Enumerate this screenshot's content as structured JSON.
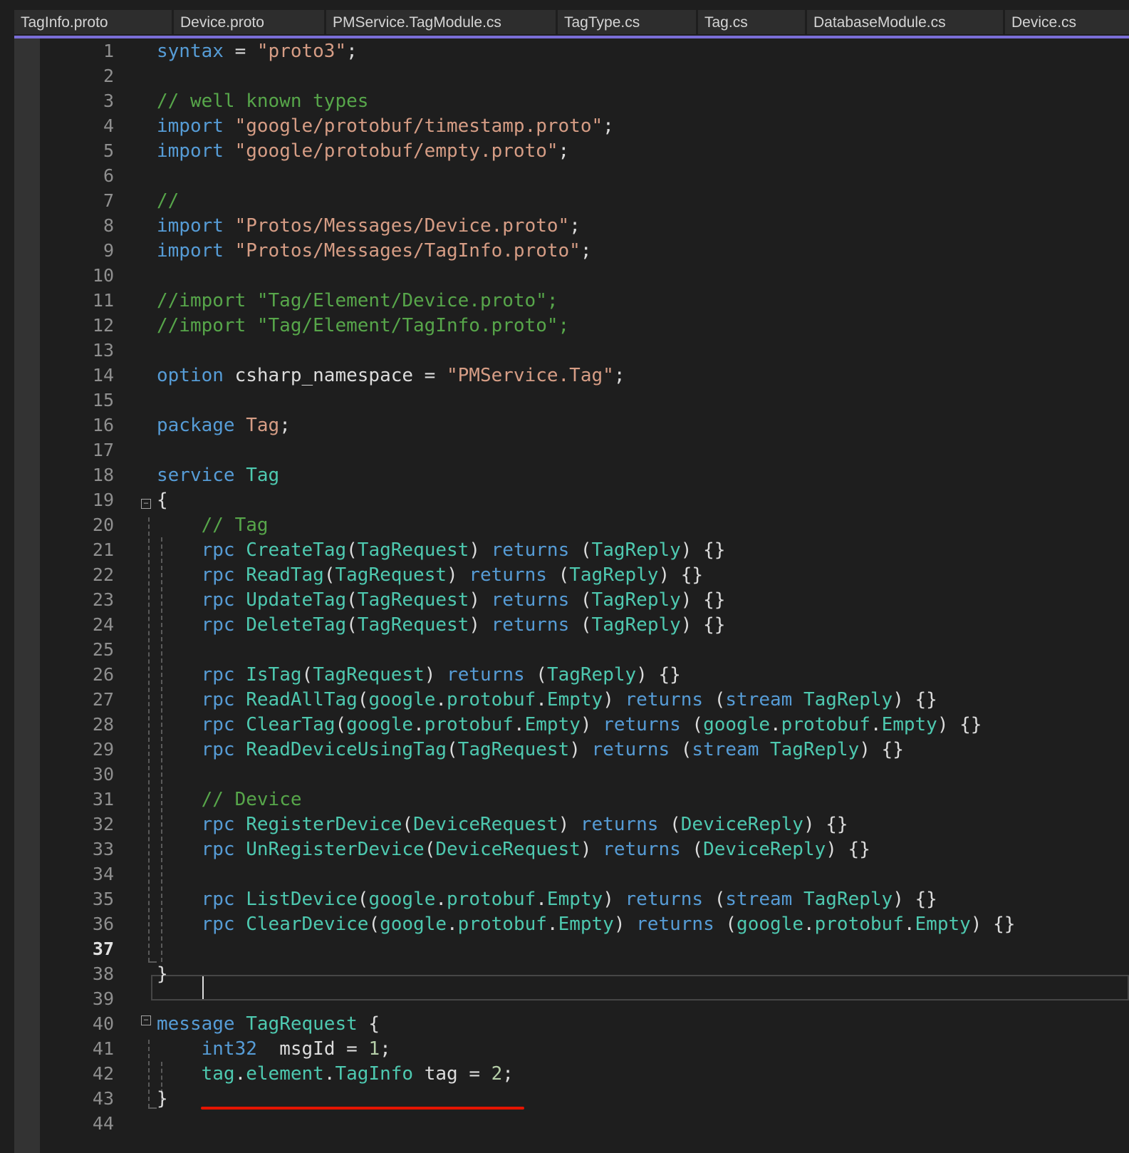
{
  "tabs": [
    {
      "label": "TagInfo.proto"
    },
    {
      "label": "Device.proto"
    },
    {
      "label": "PMService.TagModule.cs"
    },
    {
      "label": "TagType.cs"
    },
    {
      "label": "Tag.cs"
    },
    {
      "label": "DatabaseModule.cs"
    },
    {
      "label": "Device.cs"
    }
  ],
  "editor": {
    "active_line": 37,
    "lines": [
      {
        "n": "1",
        "tokens": [
          [
            "kw",
            "syntax"
          ],
          [
            "",
            " = "
          ],
          [
            "str",
            "\"proto3\""
          ],
          [
            "",
            ";"
          ]
        ]
      },
      {
        "n": "2",
        "tokens": []
      },
      {
        "n": "3",
        "tokens": [
          [
            "cm",
            "// well known types"
          ]
        ]
      },
      {
        "n": "4",
        "tokens": [
          [
            "kw",
            "import"
          ],
          [
            "",
            " "
          ],
          [
            "str",
            "\"google/protobuf/timestamp.proto\""
          ],
          [
            "",
            ";"
          ]
        ]
      },
      {
        "n": "5",
        "tokens": [
          [
            "kw",
            "import"
          ],
          [
            "",
            " "
          ],
          [
            "str",
            "\"google/protobuf/empty.proto\""
          ],
          [
            "",
            ";"
          ]
        ]
      },
      {
        "n": "6",
        "tokens": []
      },
      {
        "n": "7",
        "tokens": [
          [
            "cm",
            "//"
          ]
        ]
      },
      {
        "n": "8",
        "tokens": [
          [
            "kw",
            "import"
          ],
          [
            "",
            " "
          ],
          [
            "str",
            "\"Protos/Messages/Device.proto\""
          ],
          [
            "",
            ";"
          ]
        ]
      },
      {
        "n": "9",
        "tokens": [
          [
            "kw",
            "import"
          ],
          [
            "",
            " "
          ],
          [
            "str",
            "\"Protos/Messages/TagInfo.proto\""
          ],
          [
            "",
            ";"
          ]
        ]
      },
      {
        "n": "10",
        "tokens": []
      },
      {
        "n": "11",
        "tokens": [
          [
            "cm",
            "//import \"Tag/Element/Device.proto\";"
          ]
        ]
      },
      {
        "n": "12",
        "tokens": [
          [
            "cm",
            "//import \"Tag/Element/TagInfo.proto\";"
          ]
        ]
      },
      {
        "n": "13",
        "tokens": []
      },
      {
        "n": "14",
        "tokens": [
          [
            "kw",
            "option"
          ],
          [
            "",
            " csharp_namespace = "
          ],
          [
            "str",
            "\"PMService.Tag\""
          ],
          [
            "",
            ";"
          ]
        ]
      },
      {
        "n": "15",
        "tokens": []
      },
      {
        "n": "16",
        "tokens": [
          [
            "kw",
            "package"
          ],
          [
            "",
            " "
          ],
          [
            "str",
            "Tag"
          ],
          [
            "",
            ";"
          ]
        ]
      },
      {
        "n": "17",
        "tokens": []
      },
      {
        "n": "18",
        "tokens": [
          [
            "kw",
            "service"
          ],
          [
            "",
            " "
          ],
          [
            "ty",
            "Tag"
          ]
        ]
      },
      {
        "n": "19",
        "tokens": [
          [
            "",
            "{"
          ]
        ]
      },
      {
        "n": "20",
        "tokens": [
          [
            "",
            "    "
          ],
          [
            "cm",
            "// Tag"
          ]
        ]
      },
      {
        "n": "21",
        "tokens": [
          [
            "",
            "    "
          ],
          [
            "kw",
            "rpc"
          ],
          [
            "",
            " "
          ],
          [
            "ty",
            "CreateTag"
          ],
          [
            "",
            "("
          ],
          [
            "ty",
            "TagRequest"
          ],
          [
            "",
            ") "
          ],
          [
            "kw",
            "returns"
          ],
          [
            "",
            " ("
          ],
          [
            "ty",
            "TagReply"
          ],
          [
            "",
            ") {}"
          ]
        ]
      },
      {
        "n": "22",
        "tokens": [
          [
            "",
            "    "
          ],
          [
            "kw",
            "rpc"
          ],
          [
            "",
            " "
          ],
          [
            "ty",
            "ReadTag"
          ],
          [
            "",
            "("
          ],
          [
            "ty",
            "TagRequest"
          ],
          [
            "",
            ") "
          ],
          [
            "kw",
            "returns"
          ],
          [
            "",
            " ("
          ],
          [
            "ty",
            "TagReply"
          ],
          [
            "",
            ") {}"
          ]
        ]
      },
      {
        "n": "23",
        "tokens": [
          [
            "",
            "    "
          ],
          [
            "kw",
            "rpc"
          ],
          [
            "",
            " "
          ],
          [
            "ty",
            "UpdateTag"
          ],
          [
            "",
            "("
          ],
          [
            "ty",
            "TagRequest"
          ],
          [
            "",
            ") "
          ],
          [
            "kw",
            "returns"
          ],
          [
            "",
            " ("
          ],
          [
            "ty",
            "TagReply"
          ],
          [
            "",
            ") {}"
          ]
        ]
      },
      {
        "n": "24",
        "tokens": [
          [
            "",
            "    "
          ],
          [
            "kw",
            "rpc"
          ],
          [
            "",
            " "
          ],
          [
            "ty",
            "DeleteTag"
          ],
          [
            "",
            "("
          ],
          [
            "ty",
            "TagRequest"
          ],
          [
            "",
            ") "
          ],
          [
            "kw",
            "returns"
          ],
          [
            "",
            " ("
          ],
          [
            "ty",
            "TagReply"
          ],
          [
            "",
            ") {}"
          ]
        ]
      },
      {
        "n": "25",
        "tokens": []
      },
      {
        "n": "26",
        "tokens": [
          [
            "",
            "    "
          ],
          [
            "kw",
            "rpc"
          ],
          [
            "",
            " "
          ],
          [
            "ty",
            "IsTag"
          ],
          [
            "",
            "("
          ],
          [
            "ty",
            "TagRequest"
          ],
          [
            "",
            ") "
          ],
          [
            "kw",
            "returns"
          ],
          [
            "",
            " ("
          ],
          [
            "ty",
            "TagReply"
          ],
          [
            "",
            ") {}"
          ]
        ]
      },
      {
        "n": "27",
        "tokens": [
          [
            "",
            "    "
          ],
          [
            "kw",
            "rpc"
          ],
          [
            "",
            " "
          ],
          [
            "ty",
            "ReadAllTag"
          ],
          [
            "",
            "("
          ],
          [
            "ty",
            "google"
          ],
          [
            "",
            "."
          ],
          [
            "ty",
            "protobuf"
          ],
          [
            "",
            "."
          ],
          [
            "ty",
            "Empty"
          ],
          [
            "",
            ") "
          ],
          [
            "kw",
            "returns"
          ],
          [
            "",
            " ("
          ],
          [
            "kw",
            "stream"
          ],
          [
            "",
            " "
          ],
          [
            "ty",
            "TagReply"
          ],
          [
            "",
            ") {}"
          ]
        ]
      },
      {
        "n": "28",
        "tokens": [
          [
            "",
            "    "
          ],
          [
            "kw",
            "rpc"
          ],
          [
            "",
            " "
          ],
          [
            "ty",
            "ClearTag"
          ],
          [
            "",
            "("
          ],
          [
            "ty",
            "google"
          ],
          [
            "",
            "."
          ],
          [
            "ty",
            "protobuf"
          ],
          [
            "",
            "."
          ],
          [
            "ty",
            "Empty"
          ],
          [
            "",
            ") "
          ],
          [
            "kw",
            "returns"
          ],
          [
            "",
            " ("
          ],
          [
            "ty",
            "google"
          ],
          [
            "",
            "."
          ],
          [
            "ty",
            "protobuf"
          ],
          [
            "",
            "."
          ],
          [
            "ty",
            "Empty"
          ],
          [
            "",
            ") {}"
          ]
        ]
      },
      {
        "n": "29",
        "tokens": [
          [
            "",
            "    "
          ],
          [
            "kw",
            "rpc"
          ],
          [
            "",
            " "
          ],
          [
            "ty",
            "ReadDeviceUsingTag"
          ],
          [
            "",
            "("
          ],
          [
            "ty",
            "TagRequest"
          ],
          [
            "",
            ") "
          ],
          [
            "kw",
            "returns"
          ],
          [
            "",
            " ("
          ],
          [
            "kw",
            "stream"
          ],
          [
            "",
            " "
          ],
          [
            "ty",
            "TagReply"
          ],
          [
            "",
            ") {}"
          ]
        ]
      },
      {
        "n": "30",
        "tokens": []
      },
      {
        "n": "31",
        "tokens": [
          [
            "",
            "    "
          ],
          [
            "cm",
            "// Device"
          ]
        ]
      },
      {
        "n": "32",
        "tokens": [
          [
            "",
            "    "
          ],
          [
            "kw",
            "rpc"
          ],
          [
            "",
            " "
          ],
          [
            "ty",
            "RegisterDevice"
          ],
          [
            "",
            "("
          ],
          [
            "ty",
            "DeviceRequest"
          ],
          [
            "",
            ") "
          ],
          [
            "kw",
            "returns"
          ],
          [
            "",
            " ("
          ],
          [
            "ty",
            "DeviceReply"
          ],
          [
            "",
            ") {}"
          ]
        ]
      },
      {
        "n": "33",
        "tokens": [
          [
            "",
            "    "
          ],
          [
            "kw",
            "rpc"
          ],
          [
            "",
            " "
          ],
          [
            "ty",
            "UnRegisterDevice"
          ],
          [
            "",
            "("
          ],
          [
            "ty",
            "DeviceRequest"
          ],
          [
            "",
            ") "
          ],
          [
            "kw",
            "returns"
          ],
          [
            "",
            " ("
          ],
          [
            "ty",
            "DeviceReply"
          ],
          [
            "",
            ") {}"
          ]
        ]
      },
      {
        "n": "34",
        "tokens": []
      },
      {
        "n": "35",
        "tokens": [
          [
            "",
            "    "
          ],
          [
            "kw",
            "rpc"
          ],
          [
            "",
            " "
          ],
          [
            "ty",
            "ListDevice"
          ],
          [
            "",
            "("
          ],
          [
            "ty",
            "google"
          ],
          [
            "",
            "."
          ],
          [
            "ty",
            "protobuf"
          ],
          [
            "",
            "."
          ],
          [
            "ty",
            "Empty"
          ],
          [
            "",
            ") "
          ],
          [
            "kw",
            "returns"
          ],
          [
            "",
            " ("
          ],
          [
            "kw",
            "stream"
          ],
          [
            "",
            " "
          ],
          [
            "ty",
            "TagReply"
          ],
          [
            "",
            ") {}"
          ]
        ]
      },
      {
        "n": "36",
        "tokens": [
          [
            "",
            "    "
          ],
          [
            "kw",
            "rpc"
          ],
          [
            "",
            " "
          ],
          [
            "ty",
            "ClearDevice"
          ],
          [
            "",
            "("
          ],
          [
            "ty",
            "google"
          ],
          [
            "",
            "."
          ],
          [
            "ty",
            "protobuf"
          ],
          [
            "",
            "."
          ],
          [
            "ty",
            "Empty"
          ],
          [
            "",
            ") "
          ],
          [
            "kw",
            "returns"
          ],
          [
            "",
            " ("
          ],
          [
            "ty",
            "google"
          ],
          [
            "",
            "."
          ],
          [
            "ty",
            "protobuf"
          ],
          [
            "",
            "."
          ],
          [
            "ty",
            "Empty"
          ],
          [
            "",
            ") {}"
          ]
        ]
      },
      {
        "n": "37",
        "tokens": []
      },
      {
        "n": "38",
        "tokens": [
          [
            "",
            "}"
          ]
        ]
      },
      {
        "n": "39",
        "tokens": []
      },
      {
        "n": "40",
        "tokens": [
          [
            "kw",
            "message"
          ],
          [
            "",
            " "
          ],
          [
            "ty",
            "TagRequest"
          ],
          [
            "",
            " {"
          ]
        ]
      },
      {
        "n": "41",
        "tokens": [
          [
            "",
            "    "
          ],
          [
            "kw",
            "int32"
          ],
          [
            "",
            "  msgId = "
          ],
          [
            "num",
            "1"
          ],
          [
            "",
            ";"
          ]
        ]
      },
      {
        "n": "42",
        "tokens": [
          [
            "",
            "    "
          ],
          [
            "ty",
            "tag"
          ],
          [
            "",
            "."
          ],
          [
            "ty",
            "element"
          ],
          [
            "",
            "."
          ],
          [
            "ty",
            "TagInfo"
          ],
          [
            "",
            " tag = "
          ],
          [
            "num",
            "2"
          ],
          [
            "",
            ";"
          ]
        ]
      },
      {
        "n": "43",
        "tokens": [
          [
            "",
            "}"
          ]
        ]
      },
      {
        "n": "44",
        "tokens": []
      }
    ]
  }
}
